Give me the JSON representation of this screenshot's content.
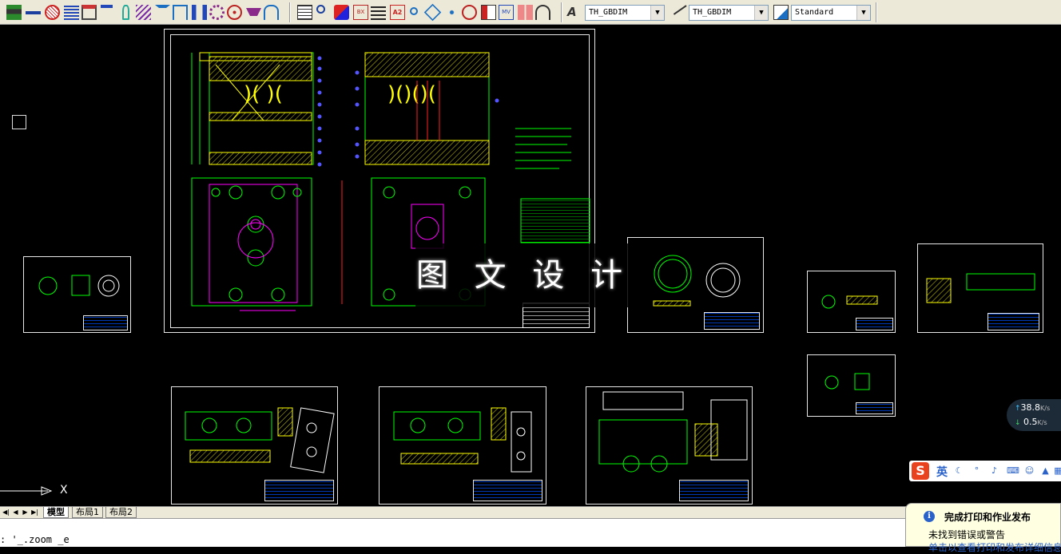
{
  "toolbar": {
    "text_style": "TH_GBDIM",
    "dim_style": "TH_GBDIM",
    "table_style": "Standard"
  },
  "watermark": "图 文 设 计",
  "tabs": [
    {
      "label": "模型"
    },
    {
      "label": "布局1"
    },
    {
      "label": "布局2"
    }
  ],
  "command_line": ": '_.zoom _e",
  "axis": {
    "x_label": "X"
  },
  "notification": {
    "title": "完成打印和作业发布",
    "message": "未找到错误或警告",
    "detail": "单击以查看打印和发布详细信息"
  },
  "net_speed": {
    "upload": "38.8",
    "download": "0.5",
    "unit": "K/s"
  },
  "ime": {
    "logo": "S",
    "mode": "英"
  },
  "colors": {
    "background": "#000000",
    "toolbar": "#ece9d8",
    "cad_green": "#00ff00",
    "cad_yellow": "#ffff00",
    "cad_magenta": "#ff00ff",
    "cad_blue": "#0050ff",
    "cad_red": "#ff2020"
  }
}
